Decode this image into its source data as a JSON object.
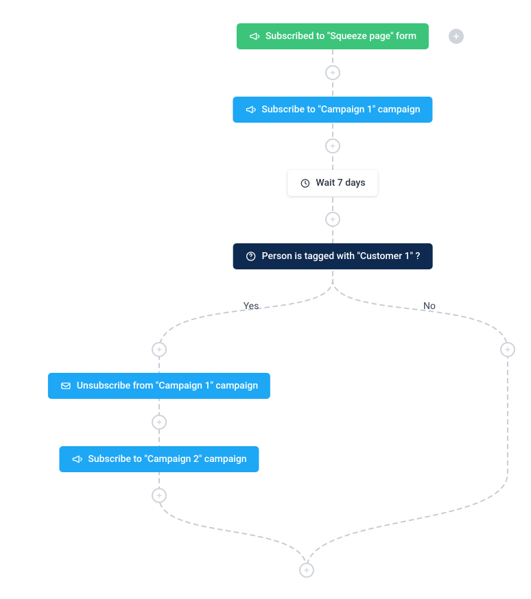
{
  "flow": {
    "trigger": {
      "label": "Subscribed to \"Squeeze page\" form"
    },
    "action1": {
      "label": "Subscribe to \"Campaign 1\" campaign"
    },
    "wait": {
      "label": "Wait 7 days"
    },
    "condition": {
      "label": "Person is tagged with \"Customer 1\" ?"
    },
    "yes_label": "Yes",
    "no_label": "No",
    "yes_action1": {
      "label": "Unsubscribe from \"Campaign 1\" campaign"
    },
    "yes_action2": {
      "label": "Subscribe to \"Campaign 2\" campaign"
    }
  },
  "colors": {
    "green": "#3bc47a",
    "blue": "#1ea7f4",
    "dark": "#0f2a50",
    "connector": "#c8ccd4",
    "add_btn": "#cfd3da"
  },
  "icons": {
    "trigger": "megaphone-icon",
    "action": "megaphone-icon",
    "wait": "clock-icon",
    "condition": "question-icon",
    "unsubscribe": "mail-off-icon"
  }
}
